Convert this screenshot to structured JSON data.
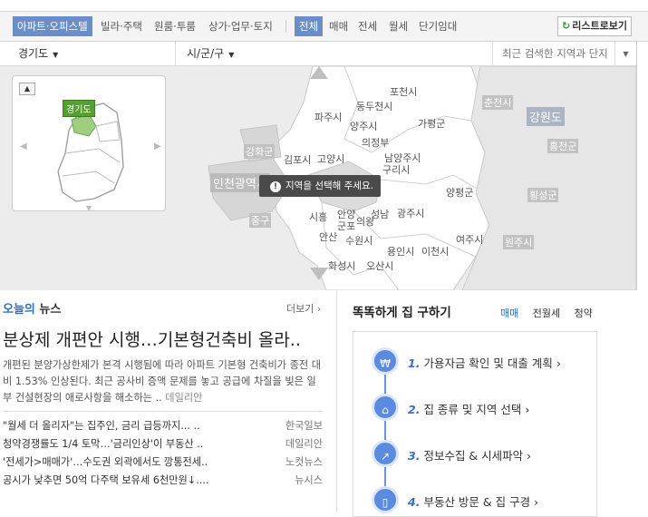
{
  "tabs": {
    "property_types": [
      "아파트·오피스텔",
      "빌라·주택",
      "원룸·투룸",
      "상가·업무·토지"
    ],
    "deal_types": [
      "전체",
      "매매",
      "전세",
      "월세",
      "단기임대"
    ],
    "list_button": "리스트로보기"
  },
  "filters": {
    "province": "경기도",
    "district": "시/군/구",
    "recent_search": "최근 검색한 지역과 단지"
  },
  "map": {
    "minimap_label": "경기도",
    "toast": "지역을 선택해 주세요.",
    "labels": [
      {
        "text": "포천시",
        "style": "plain"
      },
      {
        "text": "동두천시",
        "style": "plain"
      },
      {
        "text": "파주시",
        "style": "plain"
      },
      {
        "text": "양주시",
        "style": "plain"
      },
      {
        "text": "가평군",
        "style": "plain"
      },
      {
        "text": "의정부",
        "style": "plain"
      },
      {
        "text": "강화군",
        "style": "gray"
      },
      {
        "text": "김포시",
        "style": "plain"
      },
      {
        "text": "고양시",
        "style": "plain"
      },
      {
        "text": "남양주시",
        "style": "plain"
      },
      {
        "text": "구리시",
        "style": "plain"
      },
      {
        "text": "인천광역시",
        "style": "big"
      },
      {
        "text": "양평군",
        "style": "plain"
      },
      {
        "text": "시흥",
        "style": "plain"
      },
      {
        "text": "안양",
        "style": "plain"
      },
      {
        "text": "성남",
        "style": "plain"
      },
      {
        "text": "광주시",
        "style": "plain"
      },
      {
        "text": "군포",
        "style": "plain"
      },
      {
        "text": "의왕",
        "style": "plain"
      },
      {
        "text": "중구",
        "style": "gray"
      },
      {
        "text": "안산",
        "style": "plain"
      },
      {
        "text": "수원시",
        "style": "plain"
      },
      {
        "text": "여주시",
        "style": "plain"
      },
      {
        "text": "용인시",
        "style": "plain"
      },
      {
        "text": "이천시",
        "style": "plain"
      },
      {
        "text": "화성시",
        "style": "plain"
      },
      {
        "text": "오산시",
        "style": "plain"
      },
      {
        "text": "춘천시",
        "style": "gray"
      },
      {
        "text": "강원도",
        "style": "prov"
      },
      {
        "text": "홍천군",
        "style": "gray"
      },
      {
        "text": "횡성군",
        "style": "gray"
      },
      {
        "text": "원주시",
        "style": "gray"
      }
    ]
  },
  "news": {
    "heading_blue": "오늘의",
    "heading_rest": " 뉴스",
    "more": "더보기 ›",
    "headline": "분상제 개편안 시행…기본형건축비 올라..",
    "summary": "개편된 분양가상한제가 본격 시행됨에 따라 아파트 기본형 건축비가 종전 대비 1.53% 인상된다. 최근 공사비 증액 문제를 놓고 공급에 차질을 빚은 일부 건설현장의 애로사항을 해소하는 ..",
    "summary_source": "데일리안",
    "items": [
      {
        "title": "\"월세 더 올리자\"는 집주인, 금리 급등까지... ..",
        "source": "한국일보"
      },
      {
        "title": "청약경쟁률도 1/4 토막…'금리인상'이 부동산 ..",
        "source": "데일리안"
      },
      {
        "title": "'전세가>매매가'…수도권 외곽에서도 깡통전세..",
        "source": "노컷뉴스"
      },
      {
        "title": "공시가 낮추면 50억 다주택 보유세 6천만원↓....",
        "source": "뉴시스"
      }
    ]
  },
  "guide": {
    "title": "똑똑하게 집 구하기",
    "tabs": [
      "매매",
      "전월세",
      "청약"
    ],
    "steps": [
      {
        "num": "1.",
        "label": "가용자금 확인 및 대출 계획 ›",
        "icon": "won-icon"
      },
      {
        "num": "2.",
        "label": "집 종류 및 지역 선택 ›",
        "icon": "house-icon"
      },
      {
        "num": "3.",
        "label": "정보수집 & 시세파악 ›",
        "icon": "chart-icon"
      },
      {
        "num": "4.",
        "label": "부동산 방문 & 집 구경 ›",
        "icon": "door-icon"
      }
    ]
  }
}
